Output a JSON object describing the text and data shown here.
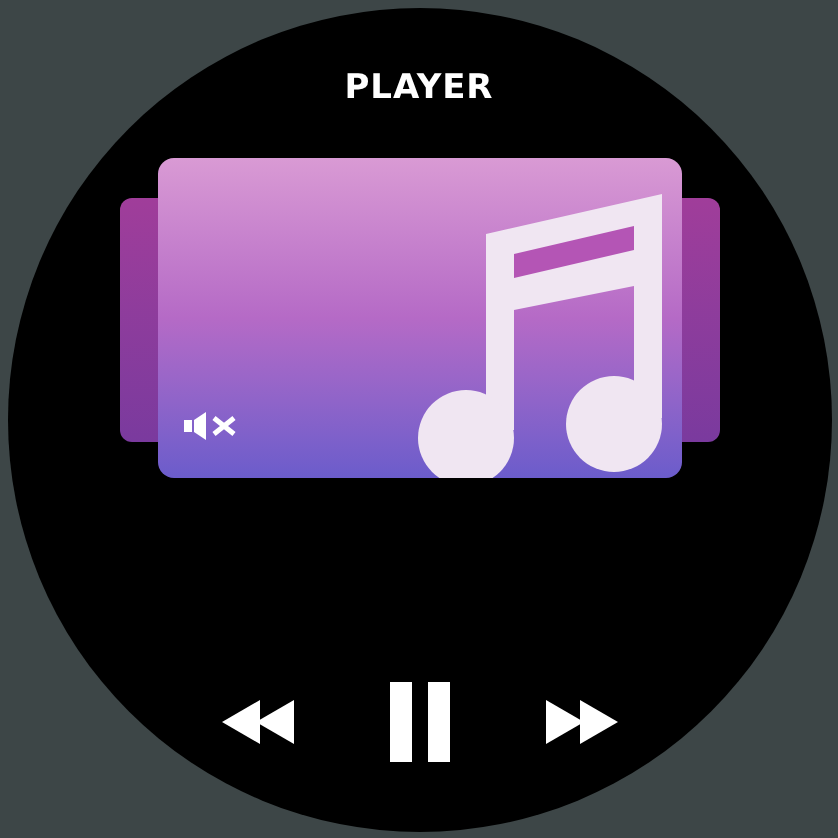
{
  "title": "PLAYER",
  "track": {
    "muted": true
  },
  "controls": {
    "playing": true
  }
}
